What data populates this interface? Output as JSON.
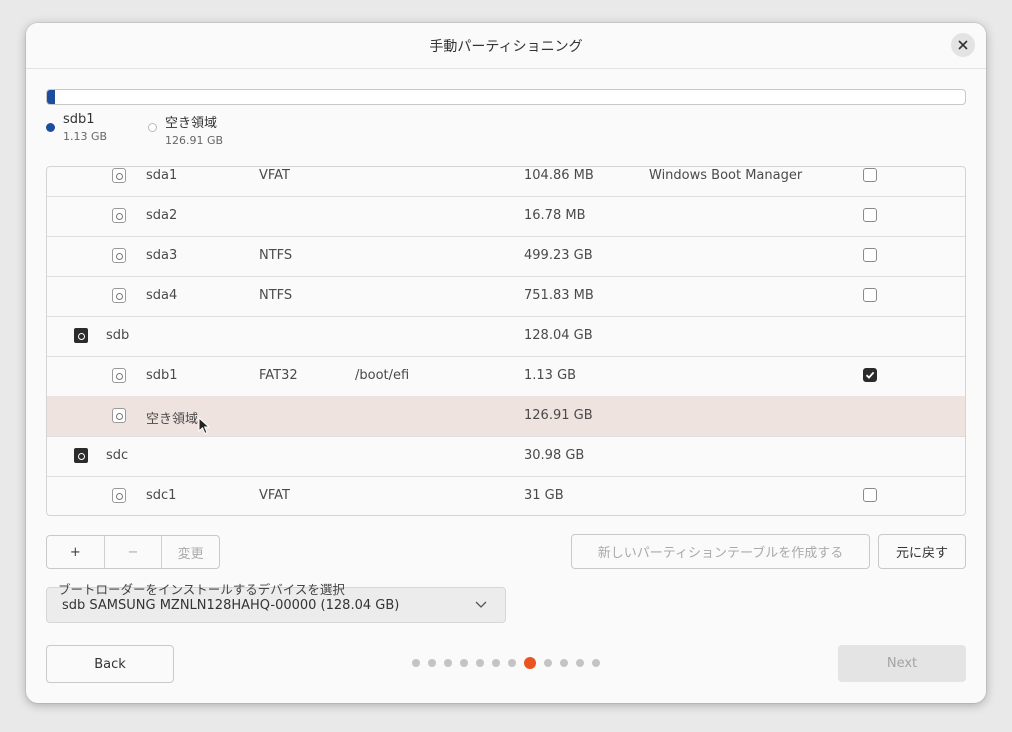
{
  "window": {
    "title": "手動パーティショニング"
  },
  "usage": {
    "used_fraction": 0.009,
    "segments": [
      {
        "name": "sdb1",
        "size": "1.13 GB",
        "color": "#1d4e9e"
      },
      {
        "name": "空き領域",
        "size": "126.91 GB",
        "color": "#ffffff"
      }
    ]
  },
  "partitions": [
    {
      "kind": "part",
      "device": "sda1",
      "type": "VFAT",
      "mount": "",
      "size": "104.86 MB",
      "system": "Windows Boot Manager",
      "checkbox": "unchecked",
      "selected": false
    },
    {
      "kind": "part",
      "device": "sda2",
      "type": "",
      "mount": "",
      "size": "16.78 MB",
      "system": "",
      "checkbox": "unchecked",
      "selected": false
    },
    {
      "kind": "part",
      "device": "sda3",
      "type": "NTFS",
      "mount": "",
      "size": "499.23 GB",
      "system": "",
      "checkbox": "unchecked",
      "selected": false
    },
    {
      "kind": "part",
      "device": "sda4",
      "type": "NTFS",
      "mount": "",
      "size": "751.83 MB",
      "system": "",
      "checkbox": "unchecked",
      "selected": false
    },
    {
      "kind": "disk",
      "device": "sdb",
      "type": "",
      "mount": "",
      "size": "128.04 GB",
      "system": "",
      "checkbox": "none",
      "selected": false
    },
    {
      "kind": "part",
      "device": "sdb1",
      "type": "FAT32",
      "mount": "/boot/efi",
      "size": "1.13 GB",
      "system": "",
      "checkbox": "checked",
      "selected": false
    },
    {
      "kind": "part",
      "device": "空き領域",
      "type": "",
      "mount": "",
      "size": "126.91 GB",
      "system": "",
      "checkbox": "none",
      "selected": true
    },
    {
      "kind": "disk",
      "device": "sdc",
      "type": "",
      "mount": "",
      "size": "30.98 GB",
      "system": "",
      "checkbox": "none",
      "selected": false
    },
    {
      "kind": "part",
      "device": "sdc1",
      "type": "VFAT",
      "mount": "",
      "size": "31 GB",
      "system": "",
      "checkbox": "unchecked",
      "selected": false
    }
  ],
  "actions": {
    "add_label": "+",
    "remove_label": "−",
    "change_label": "変更",
    "new_table_label": "新しいパーティションテーブルを作成する",
    "revert_label": "元に戻す"
  },
  "bootloader": {
    "label": "ブートローダーをインストールするデバイスを選択",
    "selected": "sdb SAMSUNG MZNLN128HAHQ-00000 (128.04 GB)"
  },
  "navigation": {
    "back_label": "Back",
    "next_label": "Next",
    "step_count": 12,
    "current_step": 8,
    "accent": "#e95420"
  }
}
